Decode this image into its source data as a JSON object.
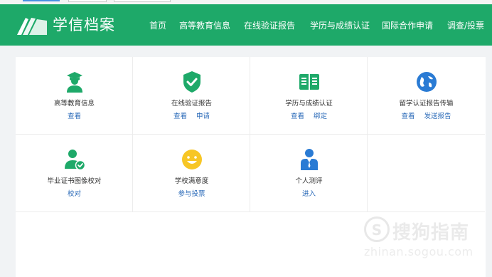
{
  "header": {
    "brand": "学信档案",
    "nav": [
      "首页",
      "高等教育信息",
      "在线验证报告",
      "学历与成绩认证",
      "国际合作申请",
      "调查/投票"
    ]
  },
  "colors": {
    "header_bg": "#1ea969",
    "link": "#2a6ab8",
    "icon_green": "#1ea969",
    "icon_yellow": "#f7c625",
    "icon_blue": "#2a7bd4"
  },
  "cards": [
    {
      "title": "高等教育信息",
      "icon": "graduate-icon",
      "links": [
        "查看"
      ]
    },
    {
      "title": "在线验证报告",
      "icon": "shield-check-icon",
      "links": [
        "查看",
        "申请"
      ]
    },
    {
      "title": "学历与成绩认证",
      "icon": "open-book-icon",
      "links": [
        "查看",
        "绑定"
      ]
    },
    {
      "title": "留学认证报告传输",
      "icon": "globe-plane-icon",
      "links": [
        "查看",
        "发送报告"
      ]
    },
    {
      "title": "毕业证书图像校对",
      "icon": "user-check-icon",
      "links": [
        "校对"
      ]
    },
    {
      "title": "学校满意度",
      "icon": "smiley-icon",
      "links": [
        "参与投票"
      ]
    },
    {
      "title": "个人测评",
      "icon": "person-tie-icon",
      "links": [
        "进入"
      ]
    }
  ],
  "watermark": {
    "text": "搜狗指南",
    "url": "zhinan.sogou.com"
  }
}
